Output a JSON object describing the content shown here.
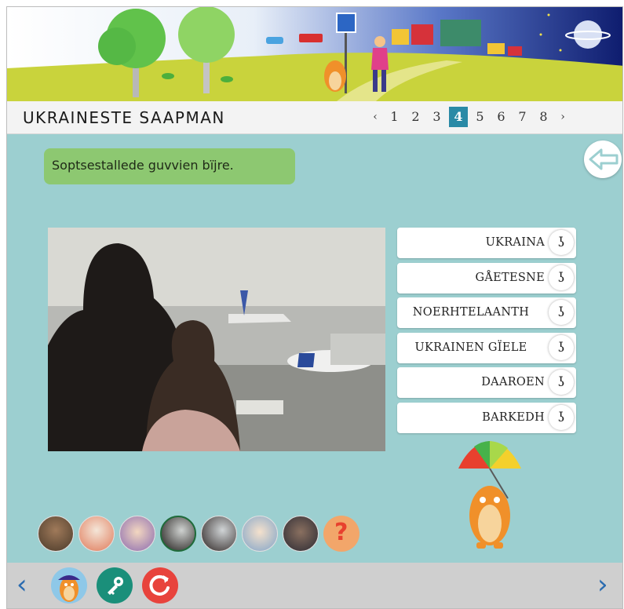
{
  "header": {
    "title": "UKRAINESTE SAAPMAN"
  },
  "pager": {
    "prev": "‹",
    "next": "›",
    "pages": [
      "1",
      "2",
      "3",
      "4",
      "5",
      "6",
      "7",
      "8"
    ],
    "current": "4"
  },
  "instruction": "Soptsestallede guvvien bïjre.",
  "options": [
    {
      "label": "UKRAINA"
    },
    {
      "label": "GÅETESNE"
    },
    {
      "label": "NOERHTELAANTH"
    },
    {
      "label": "UKRAINEN GÏELE"
    },
    {
      "label": "DAAROEN"
    },
    {
      "label": "BARKEDH"
    }
  ],
  "ear_glyph": "ʖ",
  "thumbnails": [
    {
      "name": "thumb-1",
      "active": false
    },
    {
      "name": "thumb-2",
      "active": false
    },
    {
      "name": "thumb-3",
      "active": false
    },
    {
      "name": "thumb-4",
      "active": true
    },
    {
      "name": "thumb-5",
      "active": false
    },
    {
      "name": "thumb-6",
      "active": false
    },
    {
      "name": "thumb-7",
      "active": false
    },
    {
      "name": "thumb-8",
      "active": false
    }
  ],
  "quiz_thumb_glyph": "?",
  "footer": {
    "prev": "‹",
    "next": "›"
  },
  "colors": {
    "background": "#9ccfd0",
    "instruction_bg": "#8dc871",
    "pager_active": "#2a8aa6",
    "nav_arrow": "#2a6bb0",
    "key_button": "#1a8f7a",
    "reload_button": "#e8433c"
  },
  "icons": [
    "ear-icon",
    "back-arrow-icon",
    "key-icon",
    "reload-icon",
    "mascot-icon"
  ]
}
